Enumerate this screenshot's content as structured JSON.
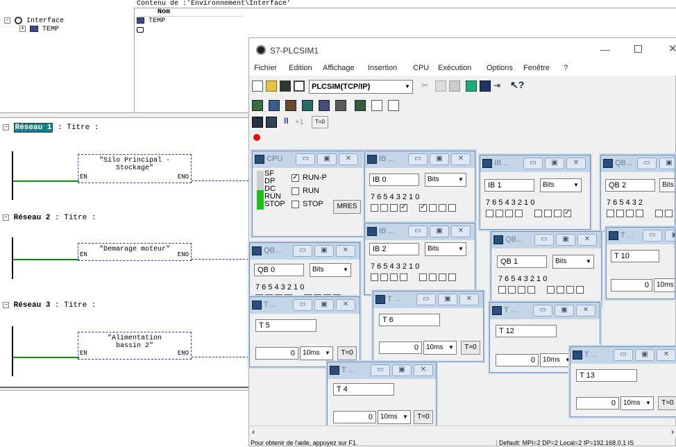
{
  "explorer": {
    "content_header": "Contenu de :'Environnement\\Interface'",
    "tree": {
      "root": "Interface",
      "child": "TEMP"
    },
    "list": {
      "col_name": "Nom",
      "item": "TEMP"
    }
  },
  "ladder": {
    "networks": [
      {
        "prefix": "Réseau",
        "num": "1",
        "title": ": Titre :",
        "block": [
          "\"Silo Principal -",
          "Stockage\""
        ],
        "en": "EN",
        "eno": "ENO"
      },
      {
        "prefix": "Réseau",
        "num": "2",
        "title": ": Titre :",
        "block": [
          "\"Demarage moteur\""
        ],
        "en": "EN",
        "eno": "ENO"
      },
      {
        "prefix": "Réseau",
        "num": "3",
        "title": ": Titre :",
        "block": [
          "\"Alimentation",
          "bassin 2\""
        ],
        "en": "EN",
        "eno": "ENO"
      }
    ]
  },
  "plcsim": {
    "title": "S7-PLCSIM1",
    "menu": [
      "Fichier",
      "Edition",
      "Affichage",
      "Insertion",
      "CPU",
      "Exécution",
      "Options",
      "Fenêtre",
      "?"
    ],
    "interface_value": "PLCSIM(TCP/IP)",
    "step_label": "+1",
    "t0_label": "T=0",
    "status_left": "Pour obtenir de l'aide, appuyez sur F1.",
    "status_right": "Default:  MPI=2 DP=2 Local=2 IP=192.168.0.1 IS"
  },
  "cpu": {
    "title": "CPU",
    "sf": "SF",
    "dp": "DP",
    "dc": "DC",
    "run": "RUN",
    "stop": "STOP",
    "run_p": "RUN-P",
    "run_opt": "RUN",
    "stop_opt": "STOP",
    "mres": "MRES",
    "run_p_checked": true
  },
  "windows": {
    "ib0": {
      "title": "IB ...",
      "addr": "IB   0",
      "fmt": "Bits",
      "bits": "7 6 5 4   3 2 1 0",
      "checked": [
        3,
        4
      ]
    },
    "ib1": {
      "title": "IB ...",
      "addr": "IB   1",
      "fmt": "Bits",
      "bits": "7 6 5 4   3 2 1 0",
      "checked": [
        7
      ]
    },
    "qb2": {
      "title": "QB...",
      "addr": "QB   2",
      "fmt": "Bits",
      "bits": "7 6 5 4   3 2"
    },
    "ib2": {
      "title": "IB ...",
      "addr": "IB   2",
      "fmt": "Bits",
      "bits": "7 6 5 4   3 2 1 0"
    },
    "qb0": {
      "title": "QB...",
      "addr": "QB   0",
      "fmt": "Bits",
      "bits": "7 6 5 4   3 2 1 0",
      "checked": [
        5,
        7
      ]
    },
    "qb1": {
      "title": "QB...",
      "addr": "QB   1",
      "fmt": "Bits",
      "bits": "7 6 5 4   3 2 1 0"
    },
    "t10": {
      "title": "T ...",
      "addr": "T   10",
      "val": "0",
      "base": "10ms"
    },
    "t5": {
      "title": "T ...",
      "addr": "T   5",
      "val": "0",
      "base": "10ms",
      "reset": "T=0"
    },
    "t6": {
      "title": "T ...",
      "addr": "T   6",
      "val": "0",
      "base": "10ms",
      "reset": "T=0"
    },
    "t12": {
      "title": "T ...",
      "addr": "T   12",
      "val": "0",
      "base": "10ms"
    },
    "t4": {
      "title": "T ...",
      "addr": "T   4",
      "val": "0",
      "base": "10ms",
      "reset": "T=0"
    },
    "t13": {
      "title": "T ...",
      "addr": "T   13",
      "val": "0",
      "base": "10ms",
      "reset": "T=0"
    }
  }
}
